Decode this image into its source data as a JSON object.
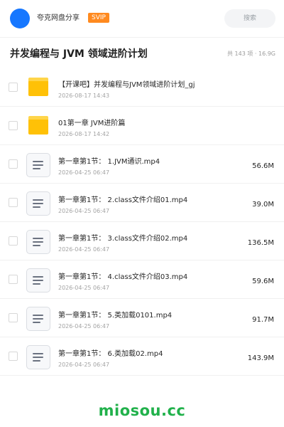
{
  "header": {
    "username": "夸克网盘分享",
    "badge": "SVIP",
    "search_placeholder": "搜索"
  },
  "title": {
    "text": "并发编程与 JVM 领域进阶计划",
    "meta": "共 143 项 · 16.9G"
  },
  "files": [
    {
      "type": "folder",
      "name": "【开课吧】并发编程与JVM领域进阶计划_gj",
      "date": "2026-08-17 14:43",
      "size": ""
    },
    {
      "type": "folder",
      "name": "01第一章 JVM进阶篇",
      "date": "2026-08-17 14:42",
      "size": ""
    },
    {
      "type": "doc",
      "name": "第一章第1节： 1.JVM通识.mp4",
      "date": "2026-04-25 06:47",
      "size": "56.6M"
    },
    {
      "type": "doc",
      "name": "第一章第1节： 2.class文件介绍01.mp4",
      "date": "2026-04-25 06:47",
      "size": "39.0M"
    },
    {
      "type": "doc",
      "name": "第一章第1节： 3.class文件介绍02.mp4",
      "date": "2026-04-25 06:47",
      "size": "136.5M"
    },
    {
      "type": "doc",
      "name": "第一章第1节： 4.class文件介绍03.mp4",
      "date": "2026-04-25 06:47",
      "size": "59.6M"
    },
    {
      "type": "doc",
      "name": "第一章第1节： 5.类加载0101.mp4",
      "date": "2026-04-25 06:47",
      "size": "91.7M"
    },
    {
      "type": "doc",
      "name": "第一章第1节： 6.类加载02.mp4",
      "date": "2026-04-25 06:47",
      "size": "143.9M"
    }
  ],
  "watermark": "miosou.cc",
  "colors": {
    "avatar": "#1677ff",
    "badge": "#ff8a1f",
    "folder": "#ffc107",
    "watermark": "#21b14b"
  },
  "icons": {
    "folder": "folder-icon",
    "doc": "document-icon"
  }
}
